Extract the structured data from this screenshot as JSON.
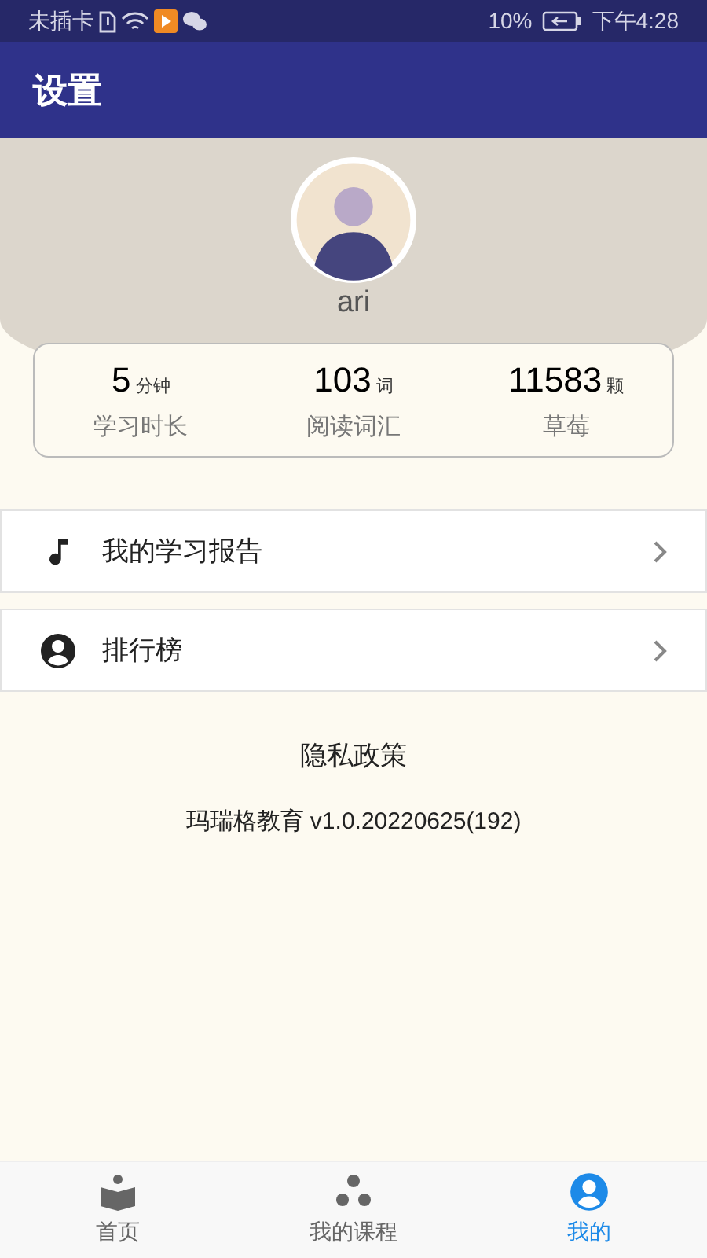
{
  "status_bar": {
    "carrier": "未插卡",
    "battery": "10%",
    "time": "下午4:28"
  },
  "header": {
    "title": "设置"
  },
  "profile": {
    "username": "ari"
  },
  "stats": [
    {
      "value": "5",
      "unit": "分钟",
      "label": "学习时长"
    },
    {
      "value": "103",
      "unit": "词",
      "label": "阅读词汇"
    },
    {
      "value": "11583",
      "unit": "颗",
      "label": "草莓"
    }
  ],
  "menu": [
    {
      "kind": "music",
      "label": "我的学习报告"
    },
    {
      "kind": "person",
      "label": "排行榜"
    }
  ],
  "privacy_link": "隐私政策",
  "version": "玛瑞格教育 v1.0.20220625(192)",
  "bottom_nav": [
    {
      "kind": "book",
      "label": "首页",
      "selected": false
    },
    {
      "kind": "dots",
      "label": "我的课程",
      "selected": false
    },
    {
      "kind": "person",
      "label": "我的",
      "selected": true
    }
  ]
}
